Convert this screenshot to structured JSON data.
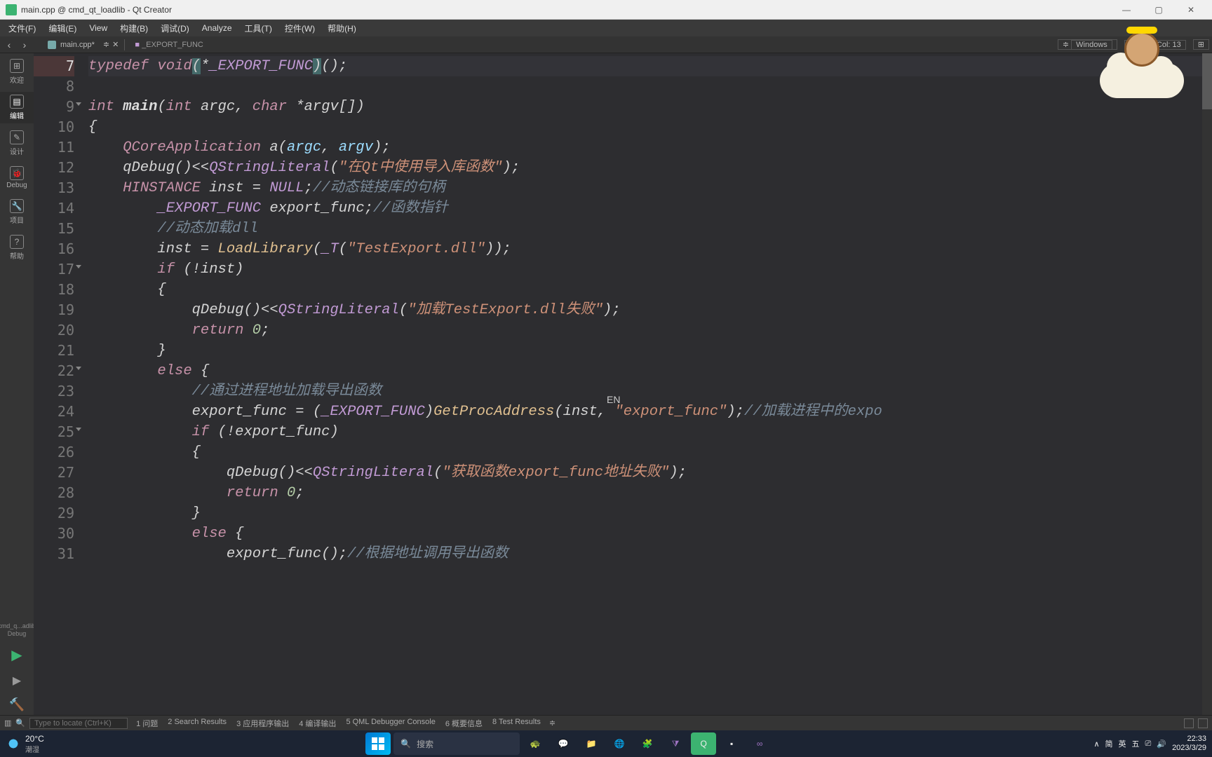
{
  "title": "main.cpp @ cmd_qt_loadlib - Qt Creator",
  "menus": [
    "文件(F)",
    "编辑(E)",
    "View",
    "构建(B)",
    "调试(D)",
    "Analyze",
    "工具(T)",
    "控件(W)",
    "帮助(H)"
  ],
  "sub_toolbar": {
    "file_tab": "main.cpp*",
    "symbol_tab": "_EXPORT_FUNC",
    "encoding": "Windows",
    "cursor": "Line: 7, Col: 13"
  },
  "modebar": {
    "items": [
      {
        "label": "欢迎",
        "icon": "⊞"
      },
      {
        "label": "编辑",
        "icon": "▤",
        "active": true
      },
      {
        "label": "设计",
        "icon": "✎"
      },
      {
        "label": "Debug",
        "icon": "🐞"
      },
      {
        "label": "项目",
        "icon": "🔧"
      },
      {
        "label": "帮助",
        "icon": "?"
      }
    ],
    "kit": "cmd_q...adlib\nDebug"
  },
  "gutter_start": 7,
  "gutter_end": 31,
  "fold_lines": [
    9,
    17,
    22,
    25
  ],
  "code_lines": [
    [
      {
        "c": "k-typedef",
        "t": "typedef "
      },
      {
        "c": "k-type",
        "t": "void"
      },
      {
        "c": "k-hl",
        "t": "("
      },
      {
        "c": "k-paren",
        "t": "*"
      },
      {
        "c": "k-macro",
        "t": "_EXPORT_FUNC"
      },
      {
        "c": "k-hl",
        "t": ")"
      },
      {
        "c": "k-paren",
        "t": "()"
      },
      {
        "c": "k-id",
        "t": ";"
      }
    ],
    [],
    [
      {
        "c": "k-type",
        "t": "int "
      },
      {
        "c": "k-funcname",
        "t": "main"
      },
      {
        "c": "k-paren",
        "t": "("
      },
      {
        "c": "k-type",
        "t": "int "
      },
      {
        "c": "k-id",
        "t": "argc"
      },
      {
        "c": "k-paren",
        "t": ", "
      },
      {
        "c": "k-type",
        "t": "char "
      },
      {
        "c": "k-paren",
        "t": "*"
      },
      {
        "c": "k-id",
        "t": "argv"
      },
      {
        "c": "k-paren",
        "t": "[])"
      }
    ],
    [
      {
        "c": "k-paren",
        "t": "{"
      }
    ],
    [
      {
        "c": "k-id",
        "t": "    "
      },
      {
        "c": "k-type",
        "t": "QCoreApplication "
      },
      {
        "c": "k-id",
        "t": "a"
      },
      {
        "c": "k-paren",
        "t": "("
      },
      {
        "c": "k-param",
        "t": "argc"
      },
      {
        "c": "k-paren",
        "t": ", "
      },
      {
        "c": "k-param",
        "t": "argv"
      },
      {
        "c": "k-paren",
        "t": ");"
      }
    ],
    [
      {
        "c": "k-id",
        "t": "    qDebug"
      },
      {
        "c": "k-paren",
        "t": "()<<"
      },
      {
        "c": "k-macro",
        "t": "QStringLiteral"
      },
      {
        "c": "k-paren",
        "t": "("
      },
      {
        "c": "k-str",
        "t": "\"在Qt中使用导入库函数\""
      },
      {
        "c": "k-paren",
        "t": ");"
      }
    ],
    [
      {
        "c": "k-id",
        "t": "    "
      },
      {
        "c": "k-type",
        "t": "HINSTANCE "
      },
      {
        "c": "k-id",
        "t": "inst = "
      },
      {
        "c": "k-macro",
        "t": "NULL"
      },
      {
        "c": "k-paren",
        "t": ";"
      },
      {
        "c": "k-com",
        "t": "//动态链接库的句柄"
      }
    ],
    [
      {
        "c": "k-id",
        "t": "        "
      },
      {
        "c": "k-macro",
        "t": "_EXPORT_FUNC "
      },
      {
        "c": "k-id",
        "t": "export_func;"
      },
      {
        "c": "k-com",
        "t": "//函数指针"
      }
    ],
    [
      {
        "c": "k-id",
        "t": "        "
      },
      {
        "c": "k-com",
        "t": "//动态加载dll"
      }
    ],
    [
      {
        "c": "k-id",
        "t": "        inst = "
      },
      {
        "c": "k-func",
        "t": "LoadLibrary"
      },
      {
        "c": "k-paren",
        "t": "("
      },
      {
        "c": "k-macro",
        "t": "_T"
      },
      {
        "c": "k-paren",
        "t": "("
      },
      {
        "c": "k-str",
        "t": "\"TestExport.dll\""
      },
      {
        "c": "k-paren",
        "t": "));"
      }
    ],
    [
      {
        "c": "k-id",
        "t": "        "
      },
      {
        "c": "k-kw",
        "t": "if "
      },
      {
        "c": "k-paren",
        "t": "(!"
      },
      {
        "c": "k-id",
        "t": "inst"
      },
      {
        "c": "k-paren",
        "t": ")"
      }
    ],
    [
      {
        "c": "k-paren",
        "t": "        {"
      }
    ],
    [
      {
        "c": "k-id",
        "t": "            qDebug"
      },
      {
        "c": "k-paren",
        "t": "()<<"
      },
      {
        "c": "k-macro",
        "t": "QStringLiteral"
      },
      {
        "c": "k-paren",
        "t": "("
      },
      {
        "c": "k-str",
        "t": "\"加载TestExport.dll失败\""
      },
      {
        "c": "k-paren",
        "t": ");"
      }
    ],
    [
      {
        "c": "k-id",
        "t": "            "
      },
      {
        "c": "k-kw",
        "t": "return "
      },
      {
        "c": "k-num",
        "t": "0"
      },
      {
        "c": "k-paren",
        "t": ";"
      }
    ],
    [
      {
        "c": "k-paren",
        "t": "        }"
      }
    ],
    [
      {
        "c": "k-id",
        "t": "        "
      },
      {
        "c": "k-kw",
        "t": "else "
      },
      {
        "c": "k-paren",
        "t": "{"
      }
    ],
    [
      {
        "c": "k-id",
        "t": "            "
      },
      {
        "c": "k-com",
        "t": "//通过进程地址加载导出函数"
      }
    ],
    [
      {
        "c": "k-id",
        "t": "            export_func = "
      },
      {
        "c": "k-paren",
        "t": "("
      },
      {
        "c": "k-macro",
        "t": "_EXPORT_FUNC"
      },
      {
        "c": "k-paren",
        "t": ")"
      },
      {
        "c": "k-func",
        "t": "GetProcAddress"
      },
      {
        "c": "k-paren",
        "t": "("
      },
      {
        "c": "k-id",
        "t": "inst"
      },
      {
        "c": "k-paren",
        "t": ", "
      },
      {
        "c": "k-str",
        "t": "\"export_func\""
      },
      {
        "c": "k-paren",
        "t": ");"
      },
      {
        "c": "k-com",
        "t": "//加载进程中的expo"
      }
    ],
    [
      {
        "c": "k-id",
        "t": "            "
      },
      {
        "c": "k-kw",
        "t": "if "
      },
      {
        "c": "k-paren",
        "t": "(!"
      },
      {
        "c": "k-id",
        "t": "export_func"
      },
      {
        "c": "k-paren",
        "t": ")"
      }
    ],
    [
      {
        "c": "k-paren",
        "t": "            {"
      }
    ],
    [
      {
        "c": "k-id",
        "t": "                qDebug"
      },
      {
        "c": "k-paren",
        "t": "()<<"
      },
      {
        "c": "k-macro",
        "t": "QStringLiteral"
      },
      {
        "c": "k-paren",
        "t": "("
      },
      {
        "c": "k-str",
        "t": "\"获取函数export_func地址失败\""
      },
      {
        "c": "k-paren",
        "t": ");"
      }
    ],
    [
      {
        "c": "k-id",
        "t": "                "
      },
      {
        "c": "k-kw",
        "t": "return "
      },
      {
        "c": "k-num",
        "t": "0"
      },
      {
        "c": "k-paren",
        "t": ";"
      }
    ],
    [
      {
        "c": "k-paren",
        "t": "            }"
      }
    ],
    [
      {
        "c": "k-id",
        "t": "            "
      },
      {
        "c": "k-kw",
        "t": "else "
      },
      {
        "c": "k-paren",
        "t": "{"
      }
    ],
    [
      {
        "c": "k-id",
        "t": "                export_func"
      },
      {
        "c": "k-paren",
        "t": "();"
      },
      {
        "c": "k-com",
        "t": "//根据地址调用导出函数"
      }
    ]
  ],
  "locator_placeholder": "Type to locate (Ctrl+K)",
  "panes": [
    "1 问题",
    "2 Search Results",
    "3 应用程序输出",
    "4 编译输出",
    "5 QML Debugger Console",
    "6 概要信息",
    "8 Test Results"
  ],
  "ime": "EN",
  "taskbar": {
    "temp": "20°C",
    "temp_label": "潮湿",
    "search": "搜索",
    "tray": [
      "∧",
      "简",
      "英",
      "五",
      "⎚",
      "🔊"
    ],
    "time": "22:33",
    "date": "2023/3/29"
  }
}
